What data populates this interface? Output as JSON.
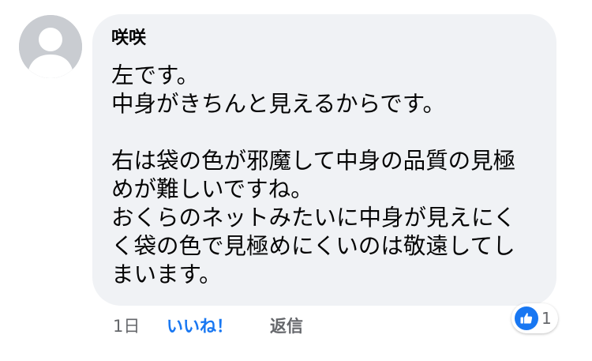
{
  "comment": {
    "author": "咲咲",
    "avatar_icon": "default-profile-silhouette",
    "lines": [
      "左です。",
      "中身がきちんと見えるからです。",
      "",
      "右は袋の色が邪魔して中身の品質の見極",
      "めが難しいですね。",
      "おくらのネットみたいに中身が見えにく",
      "く袋の色で見極めにくいのは敬遠してし",
      "まいます。"
    ],
    "bubble_color": "#f0f2f5"
  },
  "actions": {
    "timestamp": "1日",
    "like_label": "いいね！",
    "reply_label": "返信"
  },
  "reactions": {
    "icon": "thumbs-up-icon",
    "count": "1",
    "accent_color": "#1877f2"
  }
}
